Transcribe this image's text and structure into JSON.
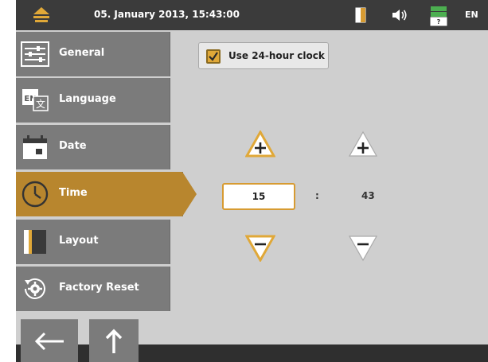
{
  "status_bar": {
    "datetime": "05. January 2013, 15:43:00",
    "language": "EN",
    "icons": [
      "yellow-logo-icon",
      "layout-battery-icon",
      "speaker-icon",
      "battery-status-icon"
    ]
  },
  "sidebar": {
    "items": [
      {
        "label": "General",
        "icon": "sliders-icon",
        "active": false
      },
      {
        "label": "Language",
        "icon": "language-icon",
        "active": false
      },
      {
        "label": "Date",
        "icon": "calendar-icon",
        "active": false
      },
      {
        "label": "Time",
        "icon": "clock-icon",
        "active": true
      },
      {
        "label": "Layout",
        "icon": "layout-icon",
        "active": false
      },
      {
        "label": "Factory Reset",
        "icon": "reset-gear-icon",
        "active": false
      }
    ]
  },
  "nav": {
    "back_icon": "arrow-left-icon",
    "up_icon": "arrow-up-icon"
  },
  "time": {
    "use_24h_label": "Use 24-hour clock",
    "use_24h_checked": true,
    "hour": "15",
    "separator": ":",
    "minute": "43"
  },
  "colors": {
    "accent": "#d79b32",
    "menu_bg": "#7b7b7b",
    "active_bg": "#b8862e",
    "status_bg": "#3b3b3b"
  }
}
